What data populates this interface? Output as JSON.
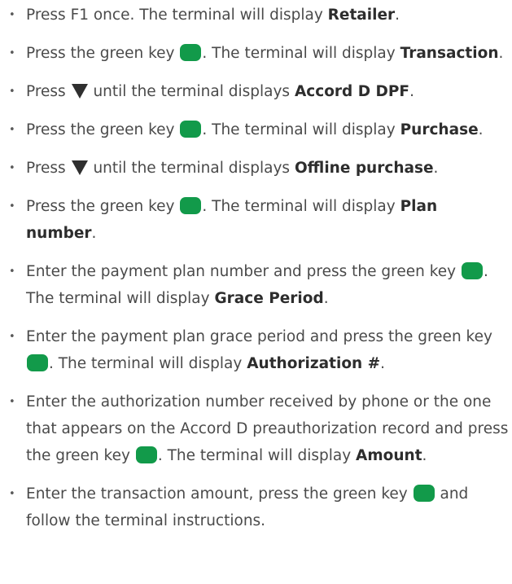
{
  "colors": {
    "green_key": "#129a4a",
    "text": "#4a4a4a",
    "bold_text": "#2d2d2d"
  },
  "icons": {
    "green_key": "green-key-icon",
    "arrow": "down-arrow-icon"
  },
  "steps": [
    {
      "segments": [
        {
          "t": "text",
          "v": "Press F1 once. The terminal will display "
        },
        {
          "t": "bold",
          "v": "Retailer"
        },
        {
          "t": "text",
          "v": "."
        }
      ]
    },
    {
      "segments": [
        {
          "t": "text",
          "v": "Press the green key "
        },
        {
          "t": "key"
        },
        {
          "t": "text",
          "v": ". The terminal will display "
        },
        {
          "t": "bold",
          "v": "Transaction"
        },
        {
          "t": "text",
          "v": "."
        }
      ]
    },
    {
      "segments": [
        {
          "t": "text",
          "v": "Press "
        },
        {
          "t": "arrow"
        },
        {
          "t": "text",
          "v": " until the terminal displays "
        },
        {
          "t": "bold",
          "v": "Accord D DPF"
        },
        {
          "t": "text",
          "v": "."
        }
      ]
    },
    {
      "segments": [
        {
          "t": "text",
          "v": "Press the green key "
        },
        {
          "t": "key"
        },
        {
          "t": "text",
          "v": ". The terminal will display "
        },
        {
          "t": "bold",
          "v": "Purchase"
        },
        {
          "t": "text",
          "v": "."
        }
      ]
    },
    {
      "segments": [
        {
          "t": "text",
          "v": "Press "
        },
        {
          "t": "arrow"
        },
        {
          "t": "text",
          "v": " until the terminal displays "
        },
        {
          "t": "bold",
          "v": "Offline purchase"
        },
        {
          "t": "text",
          "v": "."
        }
      ]
    },
    {
      "segments": [
        {
          "t": "text",
          "v": "Press the green key "
        },
        {
          "t": "key"
        },
        {
          "t": "text",
          "v": ". The terminal will display "
        },
        {
          "t": "bold",
          "v": "Plan number"
        },
        {
          "t": "text",
          "v": "."
        }
      ]
    },
    {
      "segments": [
        {
          "t": "text",
          "v": "Enter the payment plan number and press the green key "
        },
        {
          "t": "key"
        },
        {
          "t": "text",
          "v": ". The terminal will display "
        },
        {
          "t": "bold",
          "v": "Grace Period"
        },
        {
          "t": "text",
          "v": "."
        }
      ]
    },
    {
      "segments": [
        {
          "t": "text",
          "v": "Enter the payment plan grace period and press the green key "
        },
        {
          "t": "key"
        },
        {
          "t": "text",
          "v": ". The terminal will display "
        },
        {
          "t": "bold",
          "v": "Authorization #"
        },
        {
          "t": "text",
          "v": "."
        }
      ]
    },
    {
      "segments": [
        {
          "t": "text",
          "v": "Enter the authorization number received by phone or the one that appears on the Accord D preauthorization record and press the green key "
        },
        {
          "t": "key"
        },
        {
          "t": "text",
          "v": ". The terminal will display "
        },
        {
          "t": "bold",
          "v": "Amount"
        },
        {
          "t": "text",
          "v": "."
        }
      ]
    },
    {
      "segments": [
        {
          "t": "text",
          "v": "Enter the transaction amount, press the green key "
        },
        {
          "t": "key"
        },
        {
          "t": "text",
          "v": " and follow the terminal instructions."
        }
      ]
    }
  ]
}
